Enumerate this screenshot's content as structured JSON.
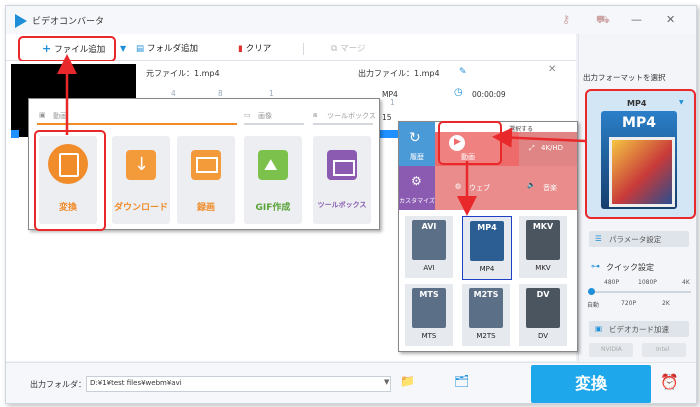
{
  "window": {
    "title": "ビデオコンバータ"
  },
  "toolbar": {
    "add_file": "ファイル追加",
    "add_folder": "フォルダ追加",
    "clear": "クリア",
    "merge": "マージ"
  },
  "file": {
    "source_label": "元ファイル：1.mp4",
    "output_label": "出力ファイル：1.mp4",
    "src_format": "MP4",
    "src_duration": "00:00:09",
    "partial_1": "15",
    "partial_2": "1",
    "partial_3": "4",
    "partial_4": "8",
    "partial_5": "1"
  },
  "main_menu": {
    "header_video": "動画",
    "header_image": "画像",
    "header_toolbox": "ツールボックス",
    "tiles": [
      {
        "label": "変換"
      },
      {
        "label": "ダウンロード"
      },
      {
        "label": "録画"
      },
      {
        "label": "GIF作成"
      },
      {
        "label": "ツールボックス"
      }
    ]
  },
  "format_menu": {
    "banner": "選択する",
    "categories": [
      {
        "label": "履歴"
      },
      {
        "label": "動画"
      },
      {
        "label": "4K/HD"
      },
      {
        "label": "カスタマイズ"
      },
      {
        "label": "ウェブ"
      },
      {
        "label": "音楽"
      }
    ],
    "formats": [
      {
        "badge": "AVI",
        "label": "AVI"
      },
      {
        "badge": "MP4",
        "label": "MP4"
      },
      {
        "badge": "MKV",
        "label": "MKV"
      },
      {
        "badge": "MTS",
        "label": "MTS"
      },
      {
        "badge": "M2TS",
        "label": "M2TS"
      },
      {
        "badge": "DV",
        "label": "DV"
      }
    ]
  },
  "right_panel": {
    "title": "出力フォーマットを選択",
    "selected_format": "MP4",
    "format_badge": "MP4",
    "params": "パラメータ設定",
    "quick": "クイック設定",
    "scale_top": [
      "480P",
      "1080P",
      "4K"
    ],
    "scale_bottom": [
      "自動",
      "720P",
      "2K"
    ],
    "gpu": "ビデオカード加速",
    "gpu_1": "NVIDIA",
    "gpu_2": "Intel"
  },
  "bottom": {
    "folder_label": "出力フォルダ：",
    "folder_path": "D:¥1¥test files¥webm¥avi",
    "convert": "変換"
  },
  "colors": {
    "accent": "#1fa7ec",
    "highlight": "#e8282b",
    "orange": "#f08c2a",
    "purple": "#8a5bb1"
  }
}
